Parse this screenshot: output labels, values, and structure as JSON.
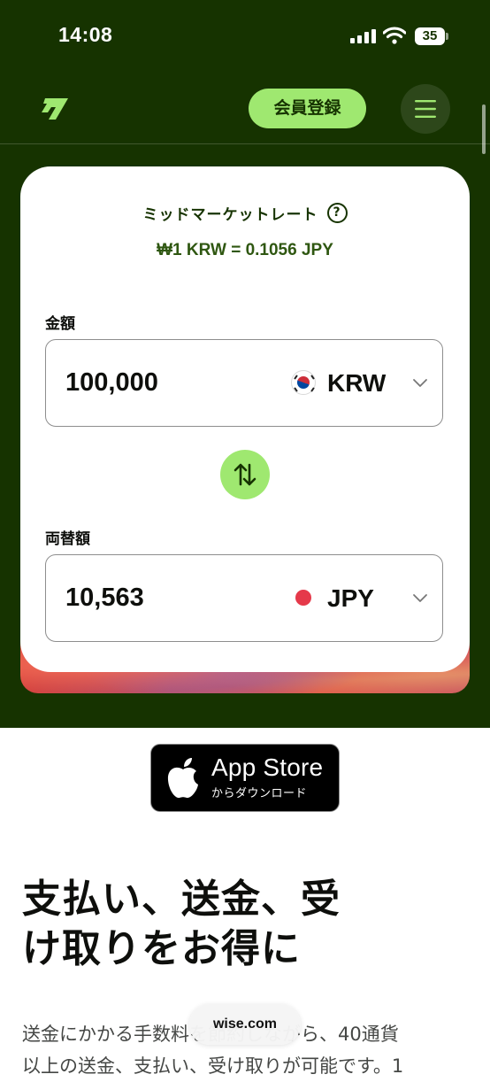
{
  "status_bar": {
    "time": "14:08",
    "battery": "35"
  },
  "nav": {
    "logo_icon": "wise-logo-icon",
    "signup_label": "会員登録",
    "menu_icon": "hamburger-menu-icon"
  },
  "converter": {
    "rate_label": "ミッドマーケットレート",
    "rate_value": "₩1 KRW = 0.1056 JPY",
    "amount_label": "金額",
    "amount_value": "100,000",
    "amount_currency": "KRW",
    "converted_label": "両替額",
    "converted_value": "10,563",
    "converted_currency": "JPY"
  },
  "app_store": {
    "title": "App Store",
    "subtitle": "からダウンロード"
  },
  "headline": {
    "line1": "支払い、送金、受",
    "line2": "け取りをお得に"
  },
  "body": {
    "line1": "送金にかかる手数料を節約しながら、40通貨",
    "line2": "以上の送金、支払い、受け取りが可能です。1"
  },
  "browser": {
    "url": "wise.com"
  },
  "colors": {
    "brand_dark": "#163300",
    "brand_green": "#9fe870",
    "text": "#0e0f0c"
  }
}
